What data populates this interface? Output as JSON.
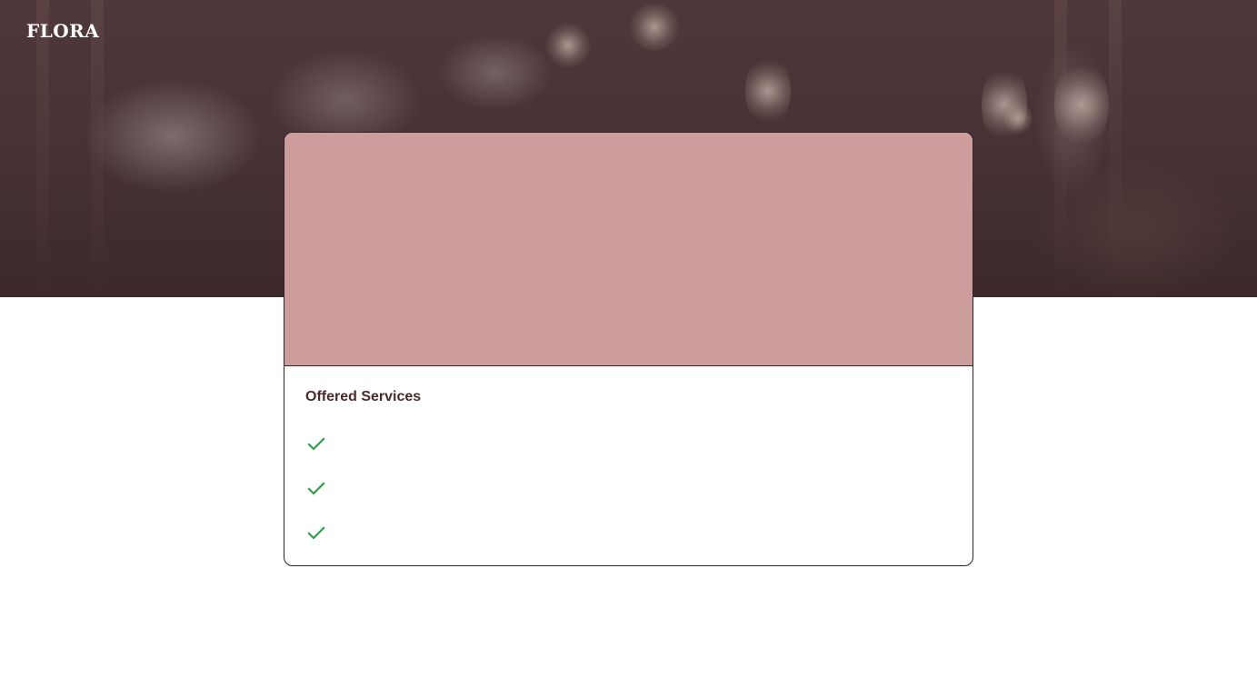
{
  "brand": {
    "logo_text": "FLORA"
  },
  "hero": {
    "image_description_icon": "banquet-hall-image"
  },
  "card": {
    "media_color": "#cd9c9c",
    "title": "Offered Services",
    "services": [
      {
        "icon": "check-icon",
        "label": ""
      },
      {
        "icon": "check-icon",
        "label": ""
      },
      {
        "icon": "check-icon",
        "label": ""
      }
    ],
    "check_color": "#2e9e4a"
  }
}
